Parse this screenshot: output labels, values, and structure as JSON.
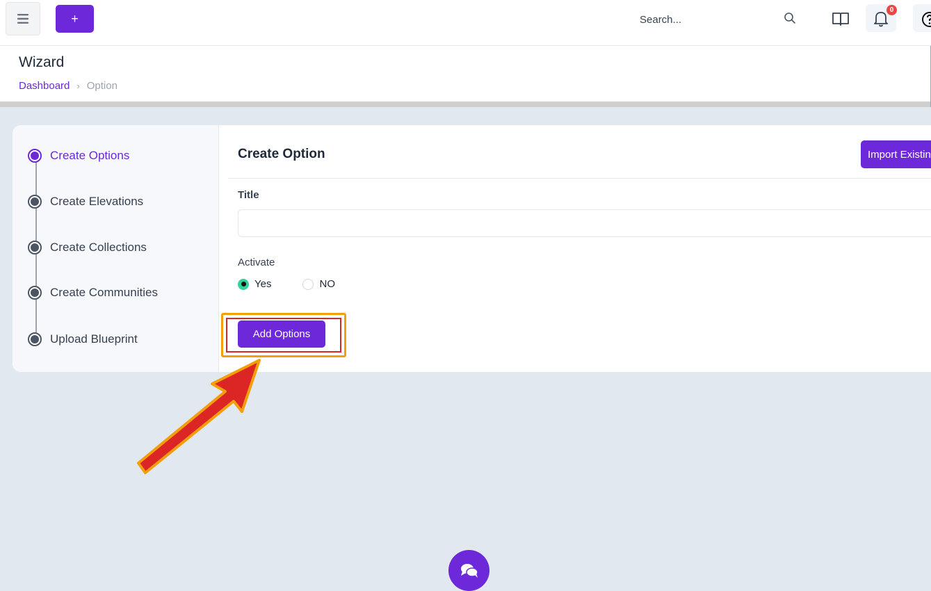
{
  "topbar": {
    "add_label": "+",
    "search_placeholder": "Search...",
    "notification_count": "0"
  },
  "header": {
    "title": "Wizard",
    "breadcrumb": [
      "Dashboard",
      "›",
      "Option"
    ]
  },
  "stepper": {
    "steps": [
      {
        "label": "Create Options",
        "active": true
      },
      {
        "label": "Create Elevations",
        "active": false
      },
      {
        "label": "Create Collections",
        "active": false
      },
      {
        "label": "Create Communities",
        "active": false
      },
      {
        "label": "Upload Blueprint",
        "active": false
      }
    ]
  },
  "form": {
    "title": "Create Option",
    "import_label": "Import Existing",
    "field_title_label": "Title",
    "field_title_value": "",
    "activate_label": "Activate",
    "radio_yes": "Yes",
    "radio_no": "NO",
    "selected": "Yes",
    "submit_label": "Add Options"
  },
  "colors": {
    "accent": "#6d28d9",
    "badge": "#ef4444",
    "radio_checked": "#34d399",
    "annotation_arrow": "#dc2626",
    "annotation_outline": "#f59e0b"
  }
}
